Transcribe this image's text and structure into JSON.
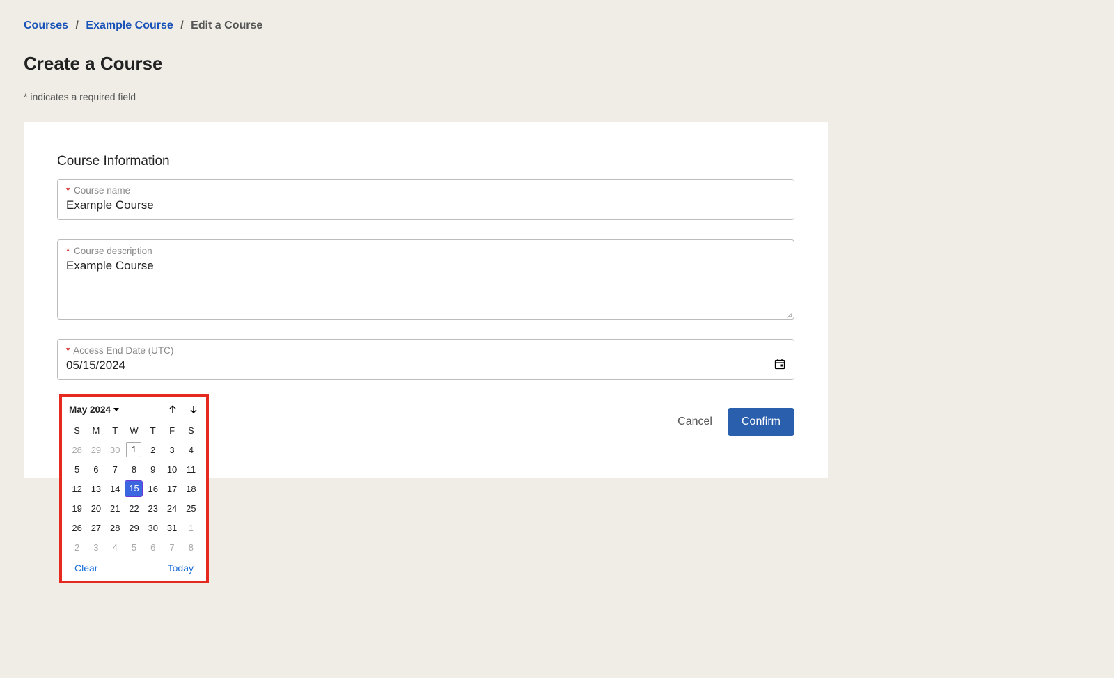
{
  "breadcrumb": {
    "items": [
      "Courses",
      "Example Course"
    ],
    "current": "Edit a Course",
    "separator": "/"
  },
  "page_title": "Create a Course",
  "required_note": "* indicates a required field",
  "section": {
    "heading": "Course Information"
  },
  "fields": {
    "course_name": {
      "label": "Course name",
      "value": "Example Course"
    },
    "course_description": {
      "label": "Course description",
      "value": "Example Course"
    },
    "access_end_date": {
      "label": "Access End Date (UTC)",
      "value": "05/15/2024"
    }
  },
  "actions": {
    "cancel": "Cancel",
    "confirm": "Confirm"
  },
  "datepicker": {
    "month_label": "May 2024",
    "weekdays": [
      "S",
      "M",
      "T",
      "W",
      "T",
      "F",
      "S"
    ],
    "weeks": [
      [
        {
          "d": "28",
          "out": true
        },
        {
          "d": "29",
          "out": true
        },
        {
          "d": "30",
          "out": true
        },
        {
          "d": "1",
          "today": true
        },
        {
          "d": "2"
        },
        {
          "d": "3"
        },
        {
          "d": "4"
        }
      ],
      [
        {
          "d": "5"
        },
        {
          "d": "6"
        },
        {
          "d": "7"
        },
        {
          "d": "8"
        },
        {
          "d": "9"
        },
        {
          "d": "10"
        },
        {
          "d": "11"
        }
      ],
      [
        {
          "d": "12"
        },
        {
          "d": "13"
        },
        {
          "d": "14"
        },
        {
          "d": "15",
          "selected": true
        },
        {
          "d": "16"
        },
        {
          "d": "17"
        },
        {
          "d": "18"
        }
      ],
      [
        {
          "d": "19"
        },
        {
          "d": "20"
        },
        {
          "d": "21"
        },
        {
          "d": "22"
        },
        {
          "d": "23"
        },
        {
          "d": "24"
        },
        {
          "d": "25"
        }
      ],
      [
        {
          "d": "26"
        },
        {
          "d": "27"
        },
        {
          "d": "28"
        },
        {
          "d": "29"
        },
        {
          "d": "30"
        },
        {
          "d": "31"
        },
        {
          "d": "1",
          "out": true
        }
      ],
      [
        {
          "d": "2",
          "out": true
        },
        {
          "d": "3",
          "out": true
        },
        {
          "d": "4",
          "out": true
        },
        {
          "d": "5",
          "out": true
        },
        {
          "d": "6",
          "out": true
        },
        {
          "d": "7",
          "out": true
        },
        {
          "d": "8",
          "out": true
        }
      ]
    ],
    "clear_label": "Clear",
    "today_label": "Today"
  }
}
